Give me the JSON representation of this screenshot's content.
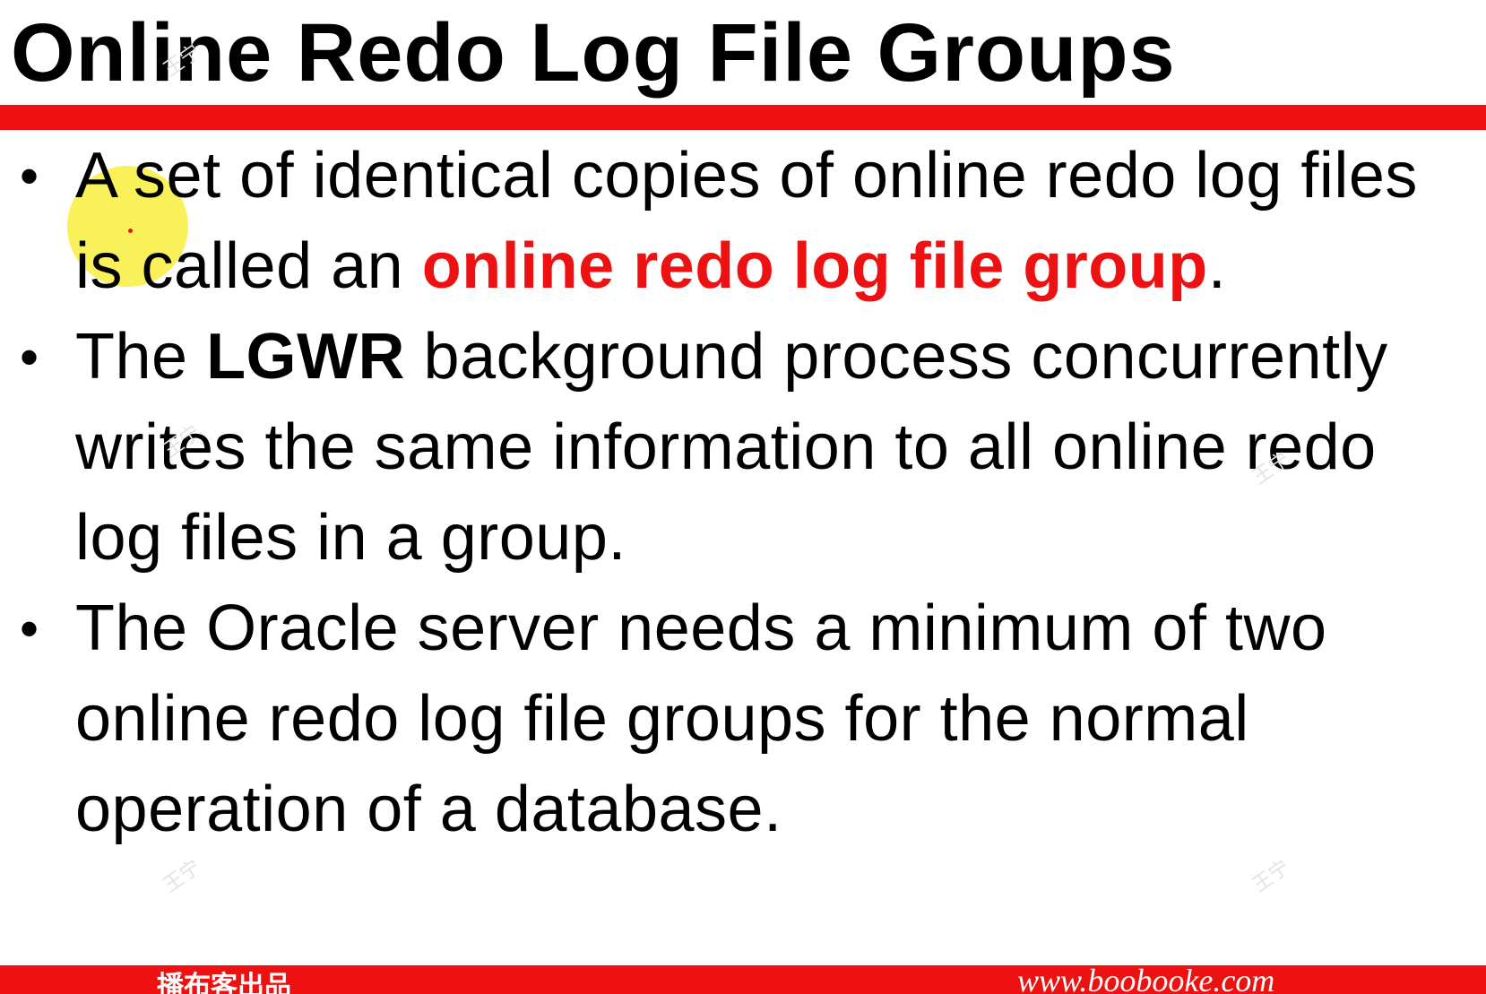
{
  "title": "Online Redo Log File Groups",
  "bullets": [
    {
      "text_before": "A set of identical copies of online redo log files is called an ",
      "emphasis": "online redo log file group",
      "text_after": "."
    },
    {
      "text_before": "The ",
      "emphasis": "LGWR",
      "text_after": " background process concurrently writes the same information to all online redo log files in a group."
    },
    {
      "text": "The Oracle server needs a minimum of two online redo log file groups for the normal operation of a database."
    }
  ],
  "watermark": "王宁",
  "footer": {
    "left_text": "播布客出品",
    "right_text": "www.boobooke.com"
  },
  "colors": {
    "accent_red": "#ee1111",
    "cursor_highlight": "#f7ee3c"
  }
}
